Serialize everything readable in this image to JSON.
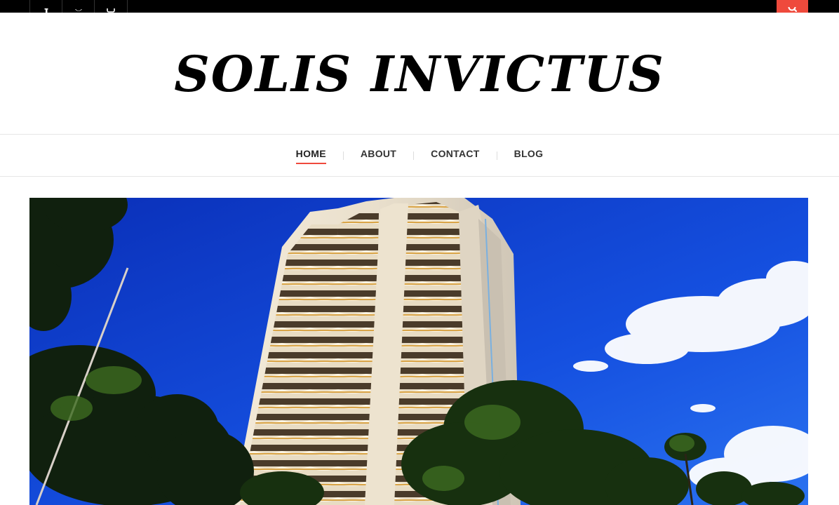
{
  "topbar": {
    "social": [
      {
        "icon": "facebook-icon"
      },
      {
        "icon": "twitter-icon"
      },
      {
        "icon": "instagram-icon"
      }
    ],
    "search": {
      "icon": "search-icon",
      "color": "#ef4a3c"
    }
  },
  "header": {
    "site_title": "SOLIS INVICTUS"
  },
  "nav": {
    "items": [
      {
        "label": "HOME",
        "active": true
      },
      {
        "label": "ABOUT",
        "active": false
      },
      {
        "label": "CONTACT",
        "active": false
      },
      {
        "label": "BLOG",
        "active": false
      }
    ],
    "accent": "#ef4a3c"
  },
  "hero": {
    "image": "high-rise-apartment-tower-blue-sky-palm-trees"
  }
}
